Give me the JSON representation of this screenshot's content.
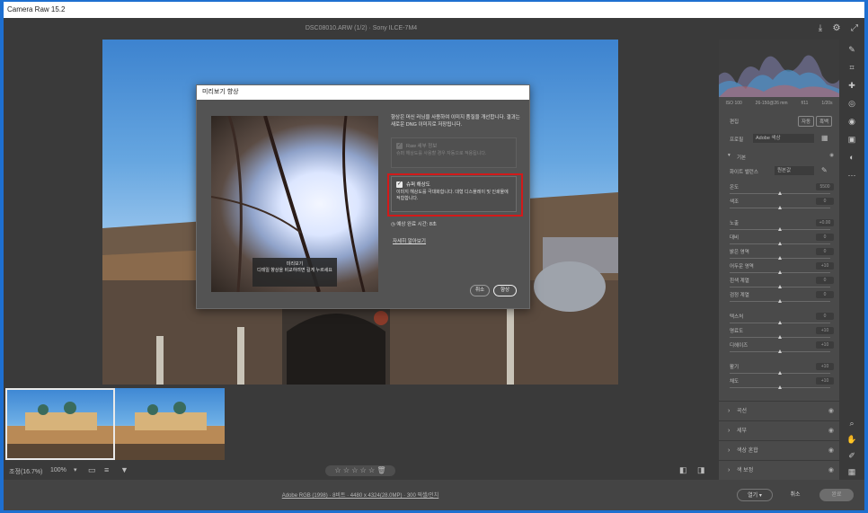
{
  "app": {
    "title": "Camera Raw 15.2"
  },
  "header": {
    "filename": "DSC08010.ARW (1/2)  ·  Sony ILCE-7M4"
  },
  "histogram": {
    "info": [
      "ISO 100",
      "26-150@26 mm",
      "f/11",
      "1/20s"
    ]
  },
  "right_panel": {
    "tabs": {
      "label": "편집",
      "auto": "자동",
      "bw": "흑백"
    },
    "profile": {
      "label": "프로필",
      "value": "Adobe 색상"
    },
    "basic_section": "기본",
    "white_balance": {
      "label": "화이트 밸런스",
      "value": "원본값"
    },
    "sliders": [
      {
        "label": "온도",
        "value": "5500"
      },
      {
        "label": "색조",
        "value": "0"
      },
      {
        "label": "노출",
        "value": "+0.00"
      },
      {
        "label": "대비",
        "value": "0"
      },
      {
        "label": "밝은 영역",
        "value": "0"
      },
      {
        "label": "어두운 영역",
        "value": "+10"
      },
      {
        "label": "흰색 계열",
        "value": "0"
      },
      {
        "label": "검정 계열",
        "value": "0"
      },
      {
        "label": "텍스처",
        "value": "0"
      },
      {
        "label": "명료도",
        "value": "+10"
      },
      {
        "label": "디헤이즈",
        "value": "+10"
      },
      {
        "label": "활기",
        "value": "+10"
      },
      {
        "label": "채도",
        "value": "+10"
      }
    ],
    "sections": [
      "곡선",
      "세부",
      "색상 혼합",
      "색 보정"
    ]
  },
  "dialog": {
    "title": "미리보기 향상",
    "description": "향상은 머신 러닝을 사용하여 이미지 품질을 개선합니다. 결과는 새로운 DNG 이미지로 저장됩니다.",
    "raw_detail": {
      "title": "Raw 세부 정보",
      "text": "슈퍼 해상도를 사용할 경우 자동으로 적용됩니다."
    },
    "super_res": {
      "title": "슈퍼 해상도",
      "text": "이미지 해상도를 극대화합니다. 대형 디스플레이 및 인쇄물에 적합합니다."
    },
    "estimated_time": "예상 완료 시간: 8초",
    "learn_more": "자세히 알아보기",
    "preview_tip": [
      "미리보기",
      "디테일 향상을 비교하려면 길게 누르세요"
    ],
    "cancel": "취소",
    "enhance": "향상"
  },
  "status": {
    "zoom": "조정(16.7%)",
    "zoom_value": "100%"
  },
  "bottom": {
    "link": "Adobe RGB (1998) · 8비트 · 4480 x 4324(28.0MP) · 300 픽셀/인치",
    "open": "열기",
    "cancel": "취소",
    "done": "완료"
  },
  "colors": {
    "accent": "#1e6fd0",
    "highlight": "#d21a1a",
    "panel": "#4a4a4a"
  }
}
